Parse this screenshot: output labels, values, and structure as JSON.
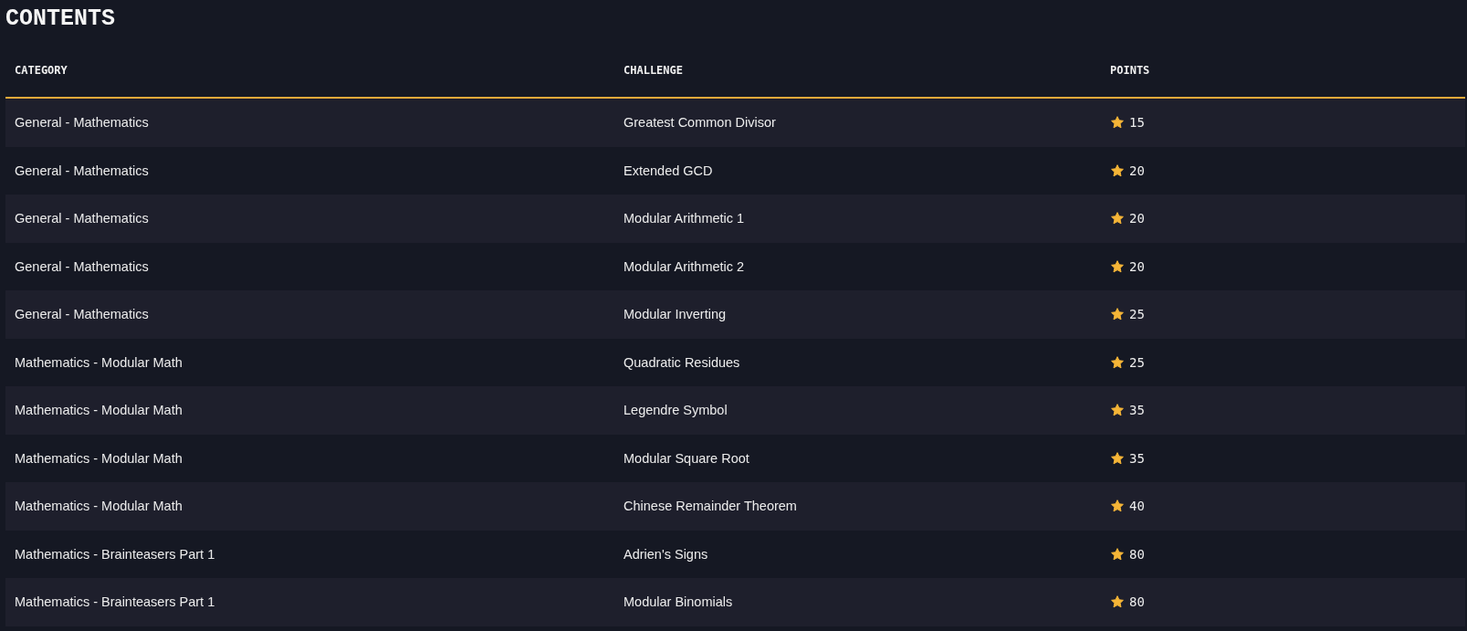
{
  "title": "CONTENTS",
  "table": {
    "columns": [
      "CATEGORY",
      "CHALLENGE",
      "POINTS"
    ],
    "rows": [
      {
        "category": "General - Mathematics",
        "challenge": "Greatest Common Divisor",
        "points": "15"
      },
      {
        "category": "General - Mathematics",
        "challenge": "Extended GCD",
        "points": "20"
      },
      {
        "category": "General - Mathematics",
        "challenge": "Modular Arithmetic 1",
        "points": "20"
      },
      {
        "category": "General - Mathematics",
        "challenge": "Modular Arithmetic 2",
        "points": "20"
      },
      {
        "category": "General - Mathematics",
        "challenge": "Modular Inverting",
        "points": "25"
      },
      {
        "category": "Mathematics - Modular Math",
        "challenge": "Quadratic Residues",
        "points": "25"
      },
      {
        "category": "Mathematics - Modular Math",
        "challenge": "Legendre Symbol",
        "points": "35"
      },
      {
        "category": "Mathematics - Modular Math",
        "challenge": "Modular Square Root",
        "points": "35"
      },
      {
        "category": "Mathematics - Modular Math",
        "challenge": "Chinese Remainder Theorem",
        "points": "40"
      },
      {
        "category": "Mathematics - Brainteasers Part 1",
        "challenge": "Adrien's Signs",
        "points": "80"
      },
      {
        "category": "Mathematics - Brainteasers Part 1",
        "challenge": "Modular Binomials",
        "points": "80"
      }
    ]
  }
}
